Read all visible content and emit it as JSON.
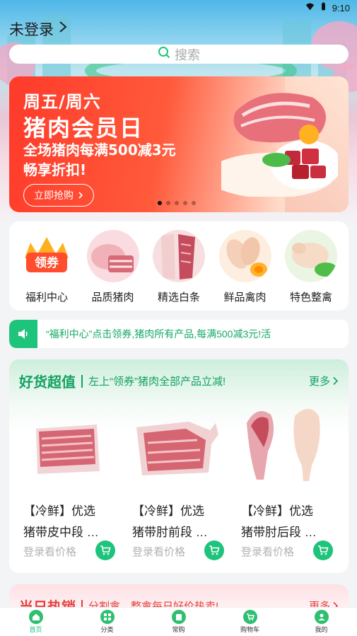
{
  "status_bar": {
    "time": "9:10"
  },
  "header": {
    "login_text": "未登录"
  },
  "search": {
    "placeholder": "搜索"
  },
  "banner": {
    "line1": "周五/周六",
    "line2": "猪肉会员日",
    "line3": "全场猪肉每满500减3元",
    "line4": "畅享折扣!",
    "button_label": "立即抢购",
    "dot_count": 5,
    "active_dot": 1
  },
  "categories": [
    {
      "label": "福利中心",
      "icon": "coupon-icon"
    },
    {
      "label": "品质猪肉",
      "icon": "pork-icon"
    },
    {
      "label": "精选白条",
      "icon": "carcass-icon"
    },
    {
      "label": "鲜品禽肉",
      "icon": "poultry-icon"
    },
    {
      "label": "特色整禽",
      "icon": "whole-chicken-icon"
    }
  ],
  "notice": {
    "text": "“福利中心”点击领券,猪肉所有产品,每满500减3元!活"
  },
  "featured": {
    "title": "好货超值",
    "subtitle": "左上“领券”猪肉全部产品立减!",
    "more": "更多",
    "products": [
      {
        "line1": "【冷鲜】优选",
        "line2": "猪带皮中段 …",
        "price": "登录看价格"
      },
      {
        "line1": "【冷鲜】优选",
        "line2": "猪带肘前段 …",
        "price": "登录看价格"
      },
      {
        "line1": "【冷鲜】优选",
        "line2": "猪带肘后段 …",
        "price": "登录看价格"
      }
    ]
  },
  "hot": {
    "title": "当日热销",
    "subtitle": "分割禽、整禽每日好价热卖!",
    "more": "更多"
  },
  "tabbar": {
    "items": [
      {
        "label": "首页",
        "icon": "home-icon",
        "active": true
      },
      {
        "label": "分类",
        "icon": "category-icon",
        "active": false
      },
      {
        "label": "常购",
        "icon": "frequent-icon",
        "active": false
      },
      {
        "label": "购物车",
        "icon": "cart-icon",
        "active": false
      },
      {
        "label": "我的",
        "icon": "profile-icon",
        "active": false
      }
    ]
  },
  "colors": {
    "brand_green": "#1ec47b",
    "banner_red": "#ff3a2a",
    "hot_red": "#e6403e"
  }
}
